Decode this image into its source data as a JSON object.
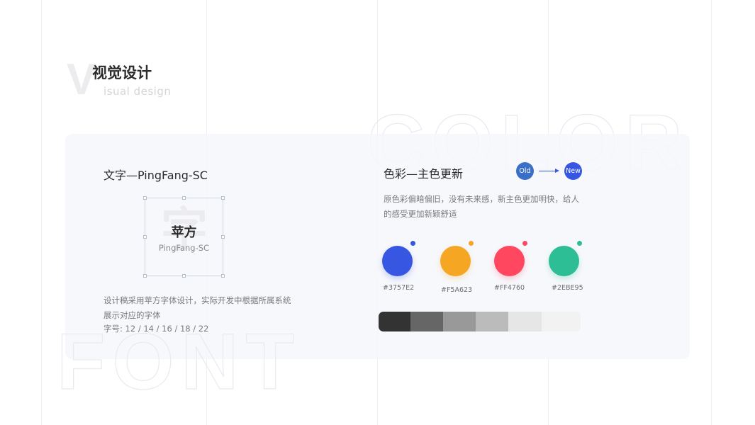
{
  "header": {
    "initial": "V",
    "title_cn": "视觉设计",
    "title_en": "isual design"
  },
  "background_words": {
    "color": "COLOR",
    "font": "FONT"
  },
  "font_section": {
    "title": "文字—PingFang-SC",
    "ghost_char": "字",
    "sample_cn": "苹方",
    "sample_en": "PingFang-SC",
    "desc_line1": "设计稿采用苹方字体设计，实际开发中根据所属系统",
    "desc_line2": "展示对应的字体",
    "sizes": "字号:   12 / 14 / 16 / 18 / 22"
  },
  "color_section": {
    "title": "色彩—主色更新",
    "old_label": "Old",
    "new_label": "New",
    "desc_line1": "原色彩偏暗偏旧，没有未来感，新主色更加明快，给人",
    "desc_line2": "的感受更加新颖舒适",
    "swatches": [
      {
        "hex": "#3757E2",
        "color": "#3757e2"
      },
      {
        "hex": "#F5A623",
        "color": "#f5a623"
      },
      {
        "hex": "#FF4760",
        "color": "#ff4760"
      },
      {
        "hex": "#2EBE95",
        "color": "#2ebe95"
      }
    ],
    "grays": [
      "#333333",
      "#666666",
      "#999999",
      "#bbbbbb",
      "#e6e6e6",
      "#f2f2f2"
    ]
  }
}
